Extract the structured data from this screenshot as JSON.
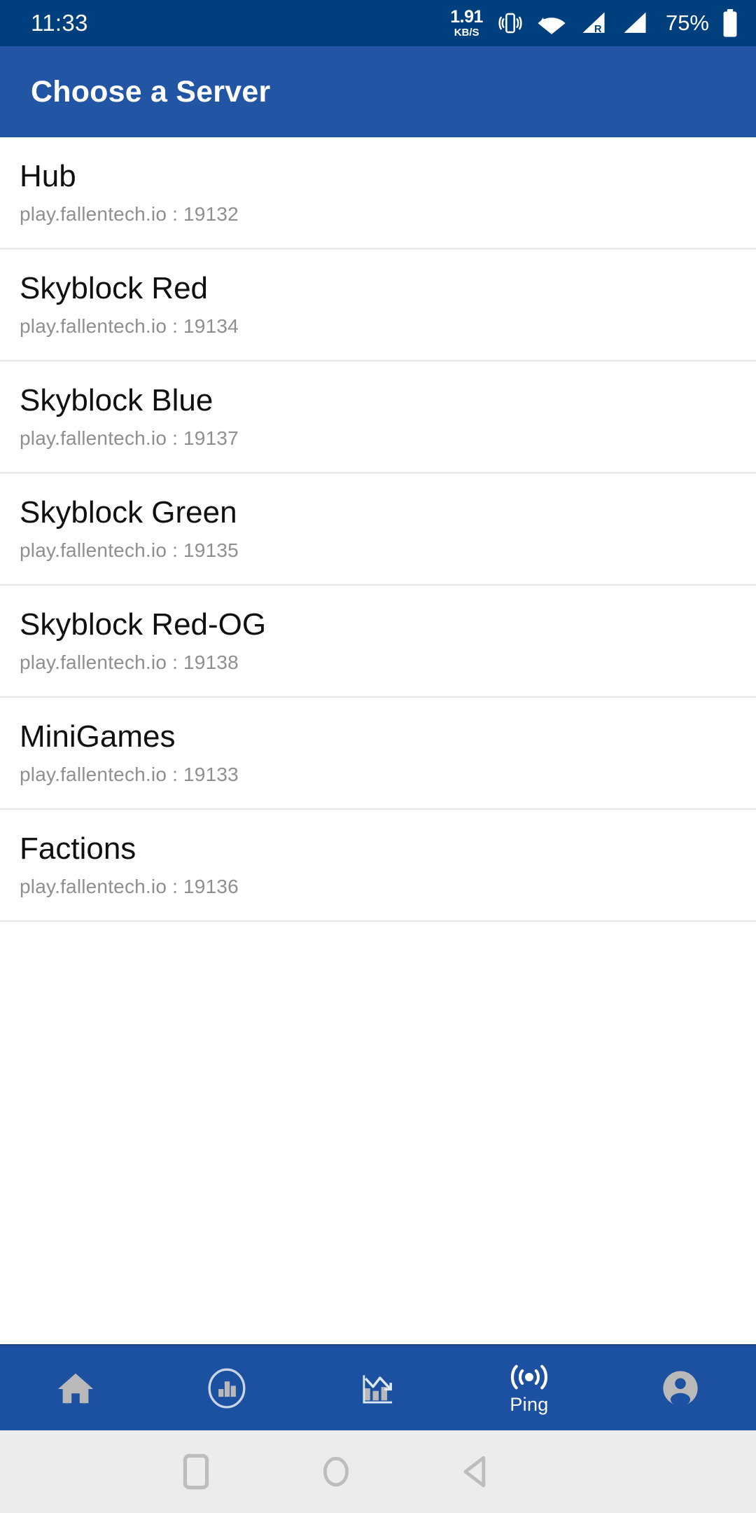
{
  "status_bar": {
    "clock": "11:33",
    "net_speed_value": "1.91",
    "net_speed_unit": "KB/S",
    "battery_percent": "75%",
    "roaming_label": "R",
    "icons": [
      "vibrate-icon",
      "wifi-icon",
      "signal-roaming-icon",
      "signal-icon",
      "battery-icon"
    ],
    "background_color": "#003f7d",
    "foreground_color": "#ffffff"
  },
  "app_bar": {
    "title": "Choose a Server",
    "background_color": "#2255a4",
    "title_color": "#ffffff"
  },
  "server_list": {
    "address_separator": " : ",
    "items": [
      {
        "name": "Hub",
        "address": "play.fallentech.io : 19132",
        "host": "play.fallentech.io",
        "port": "19132"
      },
      {
        "name": "Skyblock Red",
        "address": "play.fallentech.io : 19134",
        "host": "play.fallentech.io",
        "port": "19134"
      },
      {
        "name": "Skyblock Blue",
        "address": "play.fallentech.io : 19137",
        "host": "play.fallentech.io",
        "port": "19137"
      },
      {
        "name": "Skyblock Green",
        "address": "play.fallentech.io : 19135",
        "host": "play.fallentech.io",
        "port": "19135"
      },
      {
        "name": "Skyblock Red-OG",
        "address": "play.fallentech.io : 19138",
        "host": "play.fallentech.io",
        "port": "19138"
      },
      {
        "name": "MiniGames",
        "address": "play.fallentech.io : 19133",
        "host": "play.fallentech.io",
        "port": "19133"
      },
      {
        "name": "Factions",
        "address": "play.fallentech.io : 19136",
        "host": "play.fallentech.io",
        "port": "19136"
      }
    ],
    "name_color": "#101010",
    "address_color": "#8f8f8f",
    "divider_color": "#e8e8e8"
  },
  "bottom_nav": {
    "background_color": "#1c50a0",
    "inactive_icon_color": "#b9b9b9",
    "active_color": "#ffffff",
    "items": [
      {
        "icon": "home-icon",
        "label": "",
        "active": false
      },
      {
        "icon": "leaderboard-icon",
        "label": "",
        "active": false
      },
      {
        "icon": "stats-chart-icon",
        "label": "",
        "active": false
      },
      {
        "icon": "ping-broadcast-icon",
        "label": "Ping",
        "active": true
      },
      {
        "icon": "account-icon",
        "label": "",
        "active": false
      }
    ]
  },
  "system_nav": {
    "background_color": "#ececec",
    "icon_color": "#bdbdbd",
    "buttons": [
      {
        "icon": "recents-square-icon",
        "name": "recents"
      },
      {
        "icon": "home-circle-icon",
        "name": "home"
      },
      {
        "icon": "back-triangle-icon",
        "name": "back"
      }
    ]
  }
}
